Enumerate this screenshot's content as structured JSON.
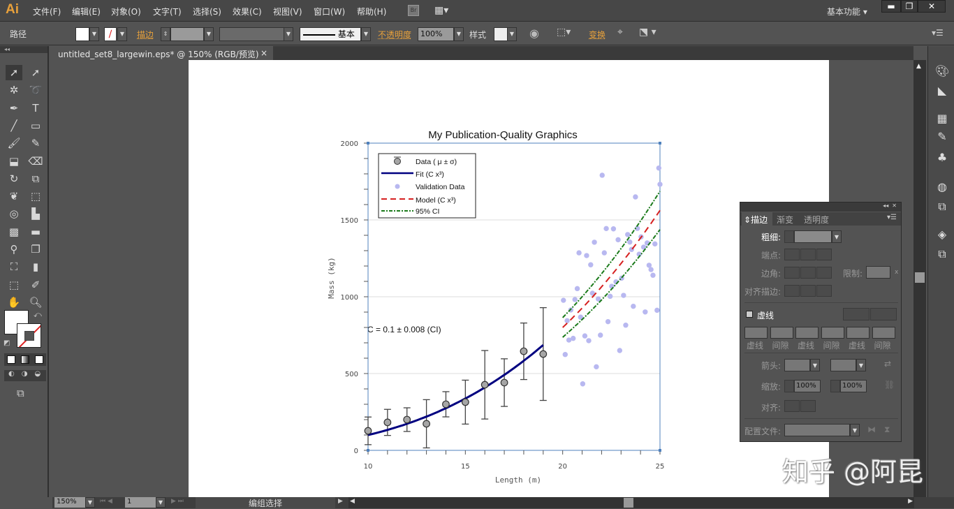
{
  "app": {
    "logo": "Ai",
    "workspace": "基本功能",
    "bridge": "Br"
  },
  "menu": [
    "文件(F)",
    "编辑(E)",
    "对象(O)",
    "文字(T)",
    "选择(S)",
    "效果(C)",
    "视图(V)",
    "窗口(W)",
    "帮助(H)"
  ],
  "control": {
    "selection": "路径",
    "stroke_label": "描边",
    "stroke_style": "基本",
    "opacity_label": "不透明度",
    "opacity": "100%",
    "style_label": "样式",
    "transform_label": "变换"
  },
  "document": {
    "tab_title": "untitled_set8_largewin.eps* @ 150% (RGB/预览)",
    "close": "×"
  },
  "status": {
    "zoom": "150%",
    "page": "1",
    "tool_status": "编组选择"
  },
  "stroke_panel": {
    "tabs": [
      "描边",
      "渐变",
      "透明度"
    ],
    "weight_label": "粗细:",
    "cap_label": "端点:",
    "corner_label": "边角:",
    "limit_label": "限制:",
    "limit_unit": "x",
    "align_label": "对齐描边:",
    "dashed_label": "虚线",
    "dash_fields": [
      "虚线",
      "间隙",
      "虚线",
      "间隙",
      "虚线",
      "间隙"
    ],
    "arrow_label": "箭头:",
    "scale_label": "缩放:",
    "scale_start": "100%",
    "scale_end": "100%",
    "arrow_align_label": "对齐:",
    "profile_label": "配置文件:"
  },
  "watermark": "知乎 @阿昆",
  "chart_data": {
    "type": "scatter",
    "title": "My Publication-Quality Graphics",
    "xlabel": "Length (m)",
    "ylabel": "Mass (kg)",
    "xlim": [
      10,
      25
    ],
    "ylim": [
      0,
      2000
    ],
    "xticks": [
      10,
      15,
      20,
      25
    ],
    "yticks": [
      0,
      500,
      1000,
      1500,
      2000
    ],
    "grid": "horizontal",
    "legend_position": "top-left",
    "annotation": "C = 0.1   ± 0.008 (CI)",
    "colors": {
      "data": "#a6a6a6",
      "fit": "#000080",
      "validation": "#b8b8f0",
      "model": "#d62020",
      "ci": "#1a7a1a",
      "axis": "#4f81bd"
    },
    "series": [
      {
        "name": "Data ( μ ± σ)",
        "kind": "errorbar",
        "x": [
          10,
          11,
          12,
          13,
          14,
          15,
          16,
          17,
          18,
          19
        ],
        "y": [
          127,
          182,
          200,
          173,
          300,
          314,
          427,
          441,
          645,
          627
        ],
        "err": [
          90,
          85,
          77,
          157,
          82,
          143,
          223,
          155,
          184,
          302
        ]
      },
      {
        "name": "Fit (C x³)",
        "kind": "line",
        "formula": "0.1*x^3",
        "x_range": [
          10,
          19
        ]
      },
      {
        "name": "Validation Data",
        "kind": "scatter",
        "x": [
          24.94,
          22.03,
          25.0,
          23.74,
          22.24,
          22.61,
          23.34,
          23.84,
          24.03,
          21.63,
          22.85,
          23.45,
          24.34,
          24.74,
          24.16,
          20.84,
          21.23,
          22.14,
          23.54,
          23.93,
          21.44,
          24.44,
          24.54,
          24.64,
          23.03,
          22.74,
          22.52,
          20.75,
          21.53,
          20.04,
          20.63,
          21.83,
          22.44,
          23.13,
          20.42,
          23.63,
          24.24,
          24.85,
          20.23,
          20.92,
          22.33,
          23.24,
          21.14,
          21.94,
          20.32,
          20.54,
          21.34,
          20.13,
          22.93,
          21.73,
          21.03
        ],
        "y": [
          1838,
          1791,
          1732,
          1650,
          1444,
          1442,
          1405,
          1445,
          1390,
          1355,
          1371,
          1356,
          1350,
          1344,
          1323,
          1286,
          1268,
          1286,
          1308,
          1277,
          1208,
          1205,
          1177,
          1140,
          1121,
          1097,
          1068,
          1053,
          1023,
          977,
          982,
          986,
          1003,
          1009,
          914,
          938,
          901,
          912,
          844,
          867,
          838,
          815,
          745,
          750,
          718,
          729,
          714,
          624,
          650,
          544,
          433
        ]
      },
      {
        "name": "Model (C x³)",
        "kind": "dashed-line",
        "formula": "0.1*x^3",
        "x_range": [
          20,
          25
        ]
      },
      {
        "name": "95% CI",
        "kind": "dashdot-band",
        "formula_upper": "0.108*x^3",
        "formula_lower": "0.092*x^3",
        "x_range": [
          20,
          25
        ]
      }
    ]
  }
}
